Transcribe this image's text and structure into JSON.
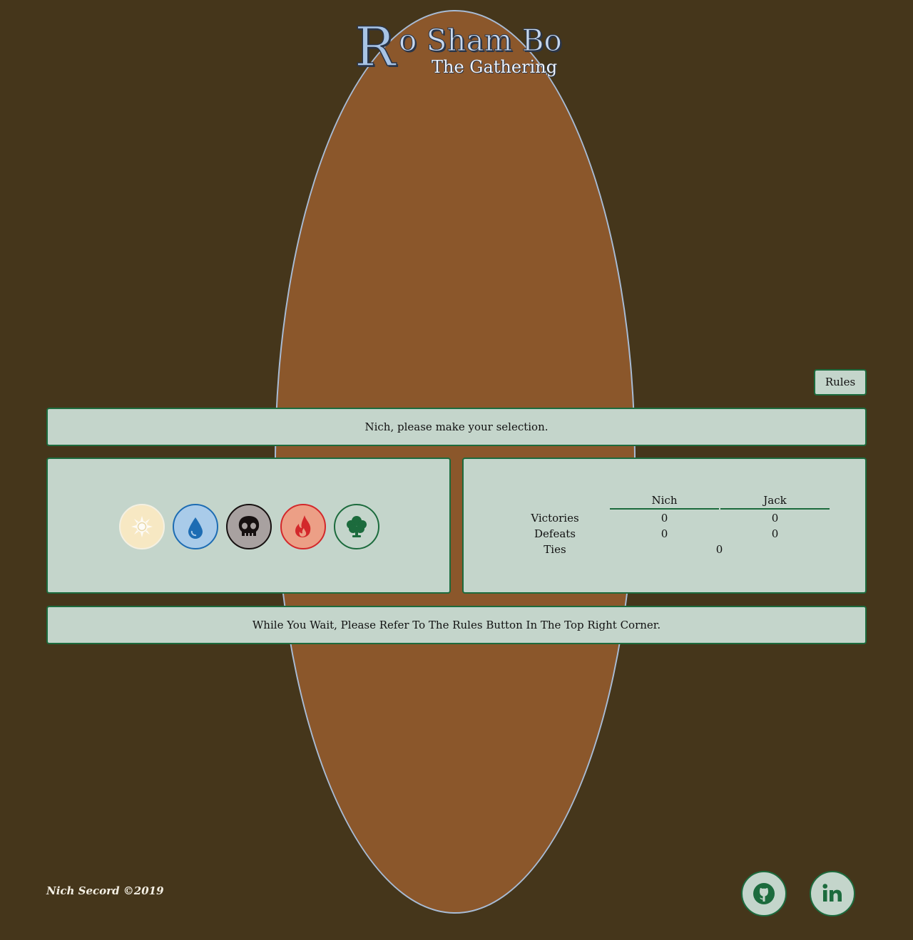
{
  "header": {
    "title_initial": "R",
    "title_rest": "o Sham Bo",
    "subtitle": "The Gathering"
  },
  "rules_button": {
    "label": "Rules"
  },
  "message": "Nich, please make your selection.",
  "mana_options": [
    {
      "name": "white-sun-icon",
      "color": "#f7e8c3"
    },
    {
      "name": "blue-water-drop-icon",
      "color": "#a9cbe9"
    },
    {
      "name": "black-skull-icon",
      "color": "#a8a1a0"
    },
    {
      "name": "red-fire-icon",
      "color": "#ec9f86"
    },
    {
      "name": "green-tree-icon",
      "color": "#c4d5cb"
    }
  ],
  "scoreboard": {
    "players": [
      "Nich",
      "Jack"
    ],
    "rows": [
      {
        "label": "Victories",
        "values": [
          "0",
          "0"
        ]
      },
      {
        "label": "Defeats",
        "values": [
          "0",
          "0"
        ]
      },
      {
        "label": "Ties",
        "value": "0"
      }
    ]
  },
  "wait_message": "While You Wait, Please Refer To The Rules Button In The Top Right Corner.",
  "footer": {
    "credit": "Nich Secord ©2019",
    "links": [
      "github-icon",
      "linkedin-icon"
    ]
  },
  "colors": {
    "background": "#45361b",
    "oval": "#8b572b",
    "panel": "#c4d5cb",
    "accent": "#1c6b3d",
    "title": "#a8c4e6"
  }
}
